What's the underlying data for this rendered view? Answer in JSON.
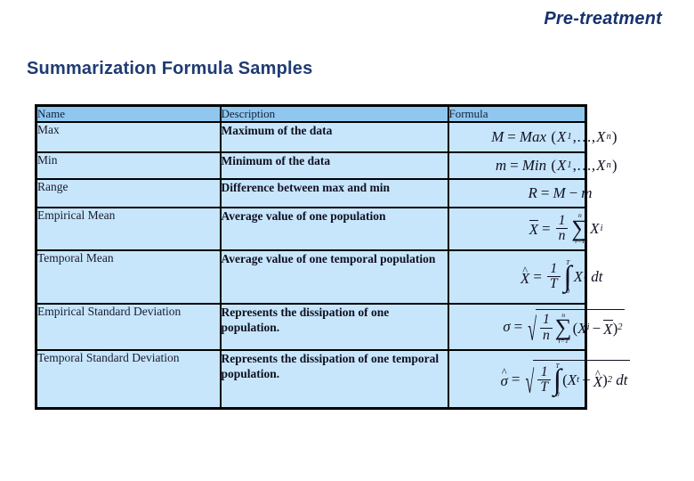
{
  "slide": {
    "corner_label": "Pre-treatment",
    "title": "Summarization Formula Samples",
    "accent_color": "#1F3B73",
    "header_row_color": "#8FC7EE",
    "body_row_color": "#C7E6FB",
    "border_color": "#000000"
  },
  "table": {
    "columns": [
      {
        "key": "name",
        "label": "Name"
      },
      {
        "key": "description",
        "label": "Description"
      },
      {
        "key": "formula",
        "label": "Formula"
      }
    ],
    "rows": [
      {
        "name": "Max",
        "description": "Maximum of the data",
        "formula_text": "M = Max (X1,..., Xn)"
      },
      {
        "name": "Min",
        "description": "Minimum of the data",
        "formula_text": "m = Min (X1,..., Xn)"
      },
      {
        "name": "Range",
        "description": "Difference between max and min",
        "formula_text": "R = M - m"
      },
      {
        "name": "Empirical Mean",
        "description": "Average value of one population",
        "formula_text": "X-bar = (1/n) sum i=1..n Xi"
      },
      {
        "name": "Temporal Mean",
        "description": "Average value of one temporal population",
        "formula_text": "X-hat = (1/T) integral 0..T Xt dt"
      },
      {
        "name": "Empirical Standard Deviation",
        "description": "Represents the dissipation of one population.",
        "formula_text": "sigma = sqrt( (1/n) sum i=1..n (Xi - X-bar)^2 )"
      },
      {
        "name": "Temporal Standard Deviation",
        "description": "Represents the dissipation of one temporal population.",
        "formula_text": "sigma-hat = sqrt( (1/T) integral 0..T (Xt - X-hat)^2 dt )"
      }
    ]
  },
  "math_symbols": {
    "sum": "∑",
    "integral": "∫",
    "radical": "√",
    "sigma": "σ",
    "minus": "−",
    "equals": "=",
    "ellipsis": "..."
  }
}
